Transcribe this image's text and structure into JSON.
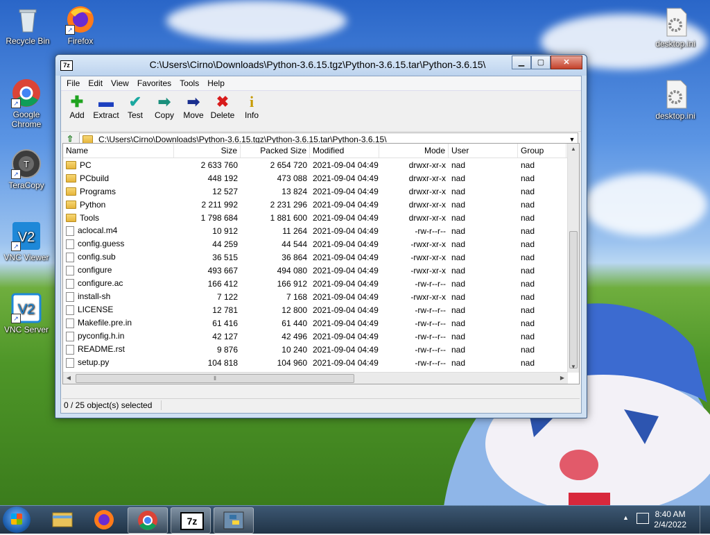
{
  "desktop": {
    "icons_left": [
      {
        "label": "Recycle Bin",
        "icon": "recycle-bin-icon"
      },
      {
        "label": "Firefox",
        "icon": "firefox-icon"
      },
      {
        "label": "Google Chrome",
        "icon": "chrome-icon"
      },
      {
        "label": "TeraCopy",
        "icon": "teracopy-icon"
      },
      {
        "label": "VNC Viewer",
        "icon": "vnc-viewer-icon"
      },
      {
        "label": "VNC Server",
        "icon": "vnc-server-icon"
      }
    ],
    "icons_right": [
      {
        "label": "desktop.ini",
        "icon": "settings-file-icon"
      },
      {
        "label": "desktop.ini",
        "icon": "settings-file-icon"
      }
    ]
  },
  "window": {
    "app_icon": "7z",
    "title": "C:\\Users\\Cirno\\Downloads\\Python-3.6.15.tgz\\Python-3.6.15.tar\\Python-3.6.15\\",
    "menu": [
      "File",
      "Edit",
      "View",
      "Favorites",
      "Tools",
      "Help"
    ],
    "toolbar": [
      {
        "label": "Add",
        "icon": "plus-icon",
        "color": "#1fa31f",
        "glyph": "✚"
      },
      {
        "label": "Extract",
        "icon": "minus-icon",
        "color": "#1c3fbf",
        "glyph": "▬"
      },
      {
        "label": "Test",
        "icon": "check-icon",
        "color": "#1aa8a0",
        "glyph": "✔"
      },
      {
        "label": "Copy",
        "icon": "copy-arrow-icon",
        "color": "#1a8f7c",
        "glyph": "➡"
      },
      {
        "label": "Move",
        "icon": "move-arrow-icon",
        "color": "#1a2f8f",
        "glyph": "➡"
      },
      {
        "label": "Delete",
        "icon": "delete-x-icon",
        "color": "#d81c1c",
        "glyph": "✖"
      },
      {
        "label": "Info",
        "icon": "info-icon",
        "color": "#c79a00",
        "glyph": "i"
      }
    ],
    "address": "C:\\Users\\Cirno\\Downloads\\Python-3.6.15.tgz\\Python-3.6.15.tar\\Python-3.6.15\\",
    "columns": {
      "name": "Name",
      "size": "Size",
      "packed": "Packed Size",
      "modified": "Modified",
      "mode": "Mode",
      "user": "User",
      "group": "Group"
    },
    "rows": [
      {
        "type": "folder",
        "name": "PC",
        "size": "2 633 760",
        "packed": "2 654 720",
        "modified": "2021-09-04 04:49",
        "mode": "drwxr-xr-x",
        "user": "nad",
        "group": "nad"
      },
      {
        "type": "folder",
        "name": "PCbuild",
        "size": "448 192",
        "packed": "473 088",
        "modified": "2021-09-04 04:49",
        "mode": "drwxr-xr-x",
        "user": "nad",
        "group": "nad"
      },
      {
        "type": "folder",
        "name": "Programs",
        "size": "12 527",
        "packed": "13 824",
        "modified": "2021-09-04 04:49",
        "mode": "drwxr-xr-x",
        "user": "nad",
        "group": "nad"
      },
      {
        "type": "folder",
        "name": "Python",
        "size": "2 211 992",
        "packed": "2 231 296",
        "modified": "2021-09-04 04:49",
        "mode": "drwxr-xr-x",
        "user": "nad",
        "group": "nad"
      },
      {
        "type": "folder",
        "name": "Tools",
        "size": "1 798 684",
        "packed": "1 881 600",
        "modified": "2021-09-04 04:49",
        "mode": "drwxr-xr-x",
        "user": "nad",
        "group": "nad"
      },
      {
        "type": "file",
        "name": "aclocal.m4",
        "size": "10 912",
        "packed": "11 264",
        "modified": "2021-09-04 04:49",
        "mode": "-rw-r--r--",
        "user": "nad",
        "group": "nad"
      },
      {
        "type": "file",
        "name": "config.guess",
        "size": "44 259",
        "packed": "44 544",
        "modified": "2021-09-04 04:49",
        "mode": "-rwxr-xr-x",
        "user": "nad",
        "group": "nad"
      },
      {
        "type": "file",
        "name": "config.sub",
        "size": "36 515",
        "packed": "36 864",
        "modified": "2021-09-04 04:49",
        "mode": "-rwxr-xr-x",
        "user": "nad",
        "group": "nad"
      },
      {
        "type": "file",
        "name": "configure",
        "size": "493 667",
        "packed": "494 080",
        "modified": "2021-09-04 04:49",
        "mode": "-rwxr-xr-x",
        "user": "nad",
        "group": "nad"
      },
      {
        "type": "file",
        "name": "configure.ac",
        "size": "166 412",
        "packed": "166 912",
        "modified": "2021-09-04 04:49",
        "mode": "-rw-r--r--",
        "user": "nad",
        "group": "nad"
      },
      {
        "type": "file",
        "name": "install-sh",
        "size": "7 122",
        "packed": "7 168",
        "modified": "2021-09-04 04:49",
        "mode": "-rwxr-xr-x",
        "user": "nad",
        "group": "nad"
      },
      {
        "type": "file",
        "name": "LICENSE",
        "size": "12 781",
        "packed": "12 800",
        "modified": "2021-09-04 04:49",
        "mode": "-rw-r--r--",
        "user": "nad",
        "group": "nad"
      },
      {
        "type": "file",
        "name": "Makefile.pre.in",
        "size": "61 416",
        "packed": "61 440",
        "modified": "2021-09-04 04:49",
        "mode": "-rw-r--r--",
        "user": "nad",
        "group": "nad"
      },
      {
        "type": "file",
        "name": "pyconfig.h.in",
        "size": "42 127",
        "packed": "42 496",
        "modified": "2021-09-04 04:49",
        "mode": "-rw-r--r--",
        "user": "nad",
        "group": "nad"
      },
      {
        "type": "file",
        "name": "README.rst",
        "size": "9 876",
        "packed": "10 240",
        "modified": "2021-09-04 04:49",
        "mode": "-rw-r--r--",
        "user": "nad",
        "group": "nad"
      },
      {
        "type": "file",
        "name": "setup.py",
        "size": "104 818",
        "packed": "104 960",
        "modified": "2021-09-04 04:49",
        "mode": "-rw-r--r--",
        "user": "nad",
        "group": "nad"
      }
    ],
    "status": "0 / 25 object(s) selected"
  },
  "taskbar": {
    "apps": [
      {
        "icon": "file-explorer-icon",
        "active": false
      },
      {
        "icon": "firefox-icon",
        "active": false
      },
      {
        "icon": "chrome-icon",
        "active": true
      },
      {
        "icon": "7zip-icon",
        "active": true,
        "label": "7z"
      },
      {
        "icon": "python-icon",
        "active": true
      }
    ],
    "time": "8:40 AM",
    "date": "2/4/2022"
  }
}
